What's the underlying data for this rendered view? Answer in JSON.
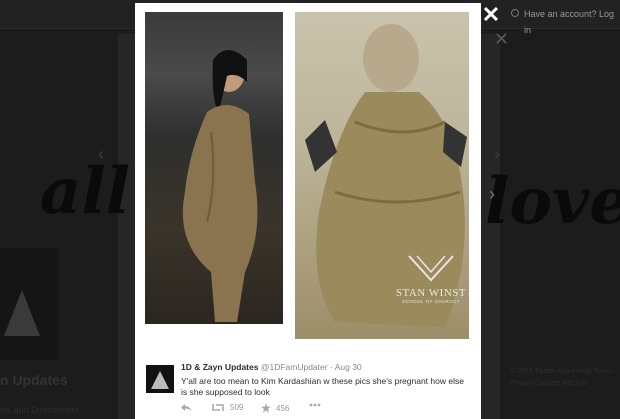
{
  "background": {
    "search_placeholder": "Have an account? Log in",
    "word_left": "all",
    "word_right": "love",
    "profile_name": "n Updates",
    "profile_follows": "ws and Directioners",
    "footer_text": "© 2015 Twitter  About  Help  Terms  Privacy  Cookies  Ads info"
  },
  "modal": {
    "close_icon": "close-icon",
    "image_left": "photo-woman-in-tan-dress",
    "image_right": "photo-penguin-costume",
    "watermark_brand": "STAN WINST",
    "watermark_sub": "SCHOOL OF CHARACT"
  },
  "tweet": {
    "display_name": "1D & Zayn Updates",
    "handle": "@1DFamUpdater",
    "separator": "·",
    "date": "Aug 30",
    "text": "Y'all are too mean to Kim Kardashian w these pics she's pregnant how else is she supposed to look",
    "retweet_count": "509",
    "favorite_count": "456",
    "icons": [
      "reply-icon",
      "retweet-icon",
      "favorite-icon",
      "more-icon"
    ]
  }
}
